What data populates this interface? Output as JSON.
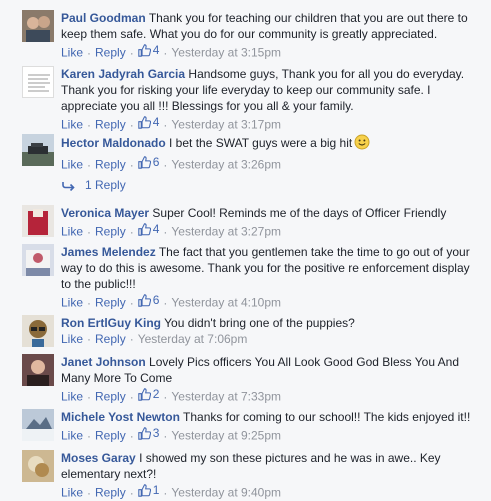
{
  "actions": {
    "like": "Like",
    "reply": "Reply",
    "dot": "·"
  },
  "reply_link": {
    "label": "1 Reply"
  },
  "colors": {
    "link": "#365899",
    "action": "#4267b2",
    "meta": "#90949c",
    "bg": "#f6f7f9"
  },
  "comments": [
    {
      "author": "Paul Goodman",
      "text": "Thank you for teaching our children that you are out there to keep them safe. What you do for our community is greatly appreciated.",
      "likes": "4",
      "time": "Yesterday at 3:15pm"
    },
    {
      "author": "Karen Jadyrah Garcia",
      "text": "Handsome guys, Thank you for all you do everyday. Thank you for risking your life everyday to keep our community safe. I appreciate you all !!! Blessings for you all & your family.",
      "likes": "4",
      "time": "Yesterday at 3:17pm"
    },
    {
      "author": "Hector Maldonado",
      "text": "I bet the SWAT guys were a big hit",
      "likes": "6",
      "time": "Yesterday at 3:26pm",
      "emoji": "smiley-emoji"
    },
    {
      "author": "Veronica Mayer",
      "text": "Super Cool! Reminds me of the days of Officer Friendly",
      "likes": "4",
      "time": "Yesterday at 3:27pm"
    },
    {
      "author": "James Melendez",
      "text": "The fact that you gentlemen take the time to go out of your way to do this is awesome. Thank you for the positive re enforcement display to the public!!!",
      "likes": "6",
      "time": "Yesterday at 4:10pm"
    },
    {
      "author": "Ron ErtlGuy King",
      "text": "You didn't bring one of the puppies?",
      "likes": "",
      "time": "Yesterday at 7:06pm"
    },
    {
      "author": "Janet Johnson",
      "text": "Lovely Pics officers You All Look Good God Bless You And Many More To Come",
      "likes": "2",
      "time": "Yesterday at 7:33pm"
    },
    {
      "author": "Michele Yost Newton",
      "text": "Thanks for coming to our school!! The kids enjoyed it!!",
      "likes": "3",
      "time": "Yesterday at 9:25pm"
    },
    {
      "author": "Moses Garay",
      "text": "I showed my son these pictures and he was in awe.. Key elementary next?!",
      "likes": "1",
      "time": "Yesterday at 9:40pm"
    }
  ]
}
